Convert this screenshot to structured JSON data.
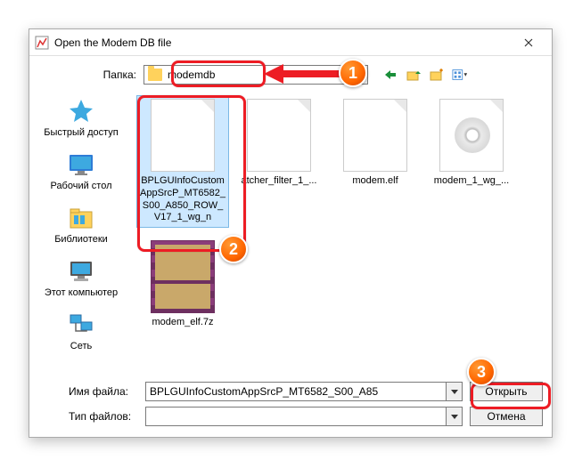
{
  "window": {
    "title": "Open the Modem DB file"
  },
  "toolbar": {
    "folder_label": "Папка:",
    "folder_value": "modemdb"
  },
  "places": [
    {
      "label": "Быстрый доступ",
      "icon": "star"
    },
    {
      "label": "Рабочий стол",
      "icon": "desktop"
    },
    {
      "label": "Библиотеки",
      "icon": "libraries"
    },
    {
      "label": "Этот компьютер",
      "icon": "computer"
    },
    {
      "label": "Сеть",
      "icon": "network"
    }
  ],
  "files": [
    {
      "label": "BPLGUInfoCustomAppSrcP_MT6582_S00_A850_ROW_V17_1_wg_n",
      "kind": "generic",
      "selected": true
    },
    {
      "label": "atcher_filter_1_...",
      "kind": "generic",
      "selected": false
    },
    {
      "label": "modem.elf",
      "kind": "generic",
      "selected": false
    },
    {
      "label": "modem_1_wg_...",
      "kind": "cd",
      "selected": false
    },
    {
      "label": "modem_elf.7z",
      "kind": "rar",
      "selected": false
    }
  ],
  "bottom": {
    "filename_label": "Имя файла:",
    "filename_value": "BPLGUInfoCustomAppSrcP_MT6582_S00_A85",
    "filetype_label": "Тип файлов:",
    "filetype_value": "",
    "open_btn": "Открыть",
    "cancel_btn": "Отмена"
  },
  "badges": {
    "b1": "1",
    "b2": "2",
    "b3": "3"
  }
}
